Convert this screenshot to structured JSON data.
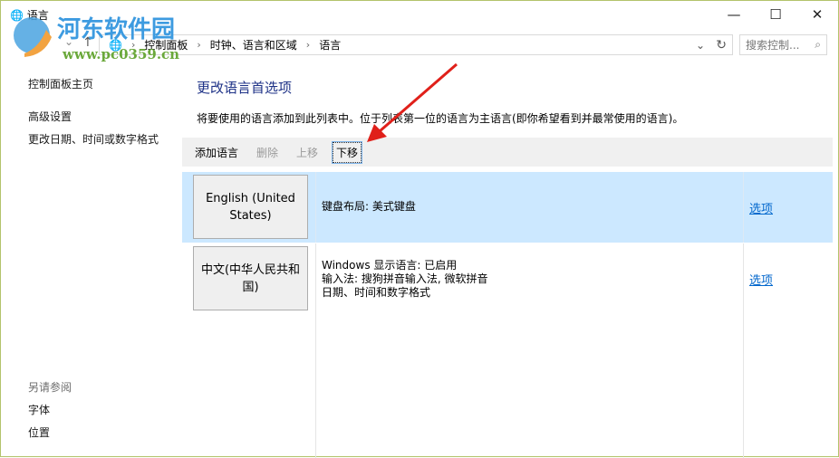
{
  "window": {
    "title": "语言",
    "minimize": "—",
    "maximize": "☐",
    "close": "✕"
  },
  "address": {
    "path": [
      "控制面板",
      "时钟、语言和区域",
      "语言"
    ],
    "refresh": "↻",
    "dropdown": "⌄"
  },
  "search": {
    "placeholder": "搜索控制..."
  },
  "nav": {
    "back": "←",
    "forward": "→",
    "recent": "⌄",
    "up": "↑"
  },
  "sidebar": {
    "home": "控制面板主页",
    "links": [
      "高级设置",
      "更改日期、时间或数字格式"
    ],
    "see_also_title": "另请参阅",
    "see_also": [
      "字体",
      "位置"
    ]
  },
  "main": {
    "heading": "更改语言首选项",
    "description": "将要使用的语言添加到此列表中。位于列表第一位的语言为主语言(即你希望看到并最常使用的语言)。",
    "toolbar": {
      "add": "添加语言",
      "remove": "删除",
      "up": "上移",
      "down": "下移"
    },
    "languages": [
      {
        "name": "English (United States)",
        "details": [
          "键盘布局: 美式键盘"
        ],
        "options": "选项"
      },
      {
        "name": "中文(中华人民共和国)",
        "details": [
          "Windows 显示语言: 已启用",
          "输入法: 搜狗拼音输入法, 微软拼音",
          "日期、时间和数字格式"
        ],
        "options": "选项"
      }
    ]
  },
  "watermark": {
    "name": "河东软件园",
    "url": "www.pc0359.cn"
  },
  "colors": {
    "selected_row": "#cce8ff",
    "link": "#0066cc",
    "heading": "#1e3287",
    "arrow": "#e0201a"
  }
}
